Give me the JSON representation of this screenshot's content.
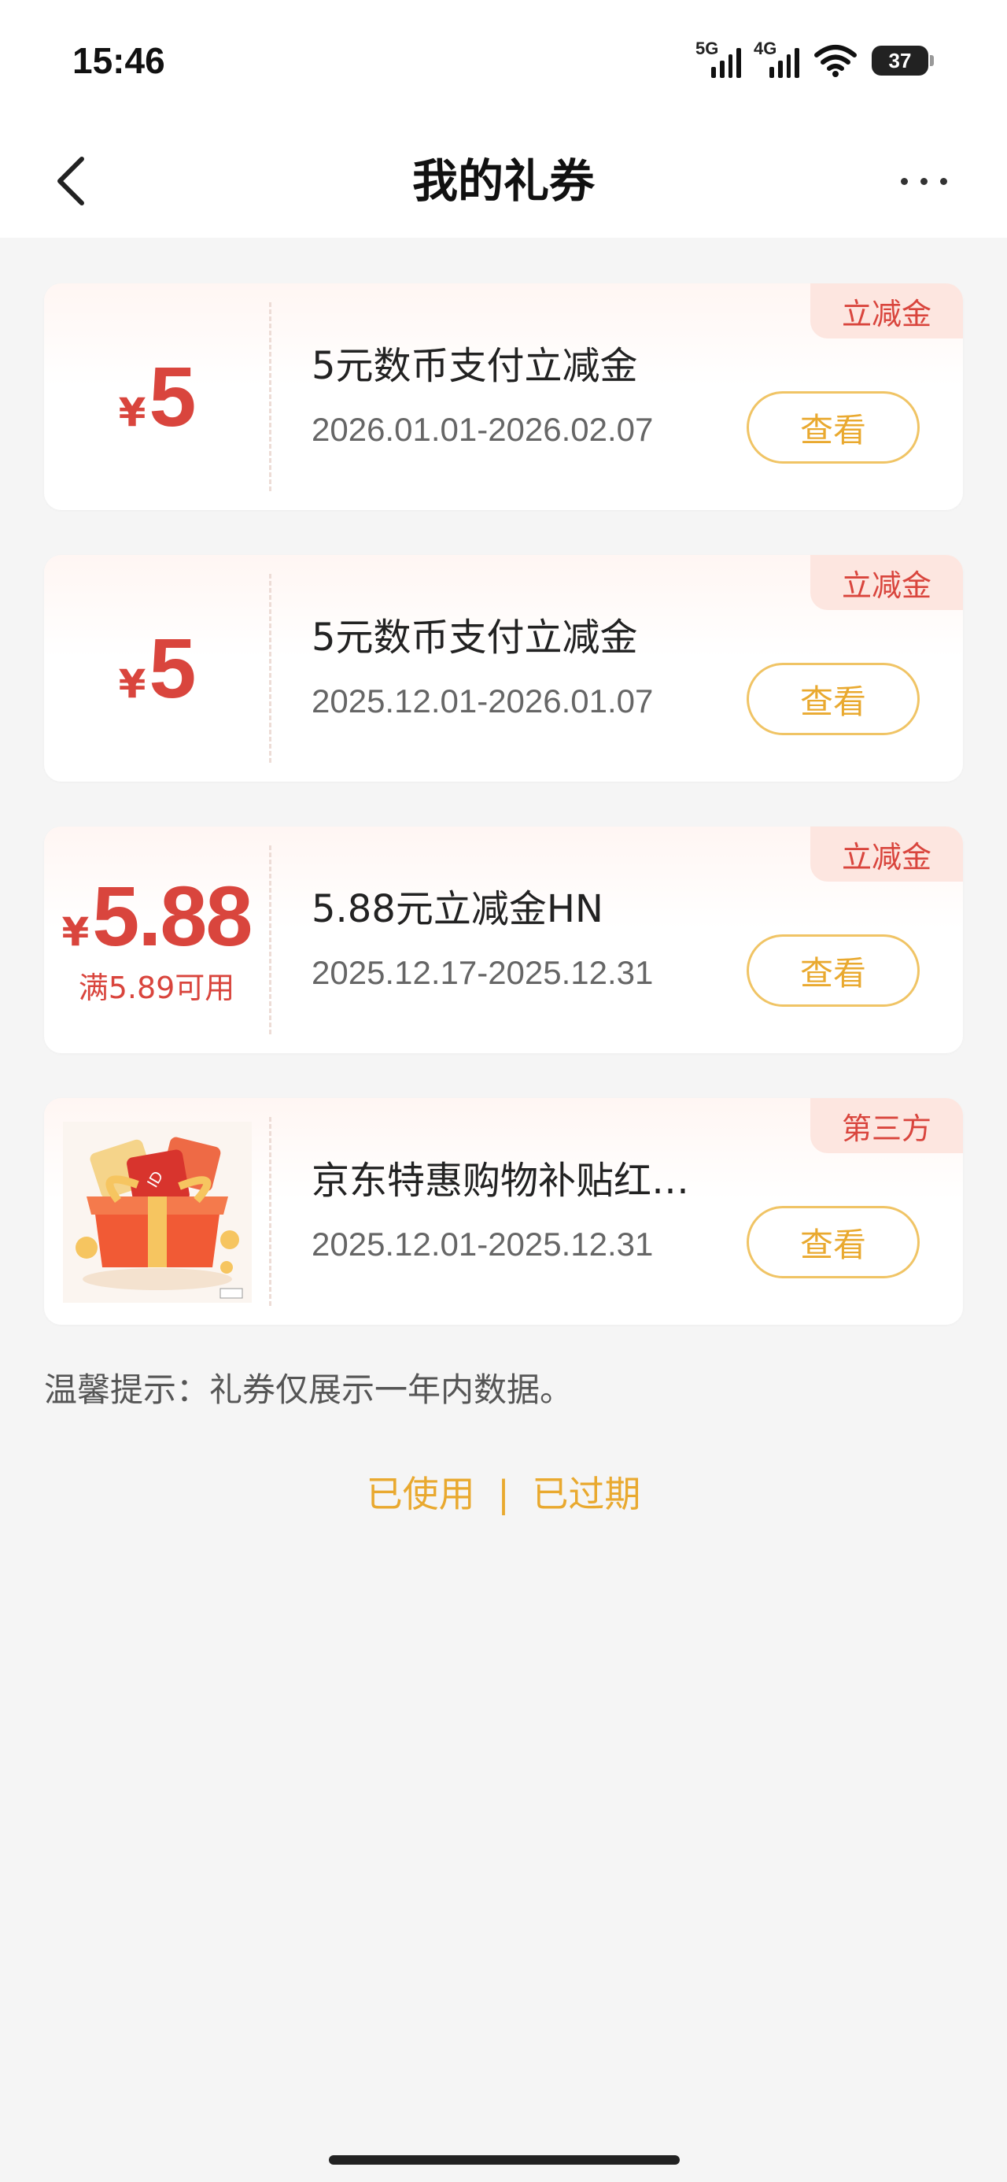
{
  "status_bar": {
    "time": "15:46",
    "network1": "5G",
    "network2": "4G",
    "battery": "37"
  },
  "header": {
    "title": "我的礼券",
    "back_icon": "chevron-left-icon",
    "more_icon": "more-horizontal-icon"
  },
  "coupons": [
    {
      "currency": "¥",
      "amount": "5",
      "condition": "",
      "title": "5元数币支付立减金",
      "date": "2026.01.01-2026.02.07",
      "tag": "立减金",
      "button": "查看"
    },
    {
      "currency": "¥",
      "amount": "5",
      "condition": "",
      "title": "5元数币支付立减金",
      "date": "2025.12.01-2026.01.07",
      "tag": "立减金",
      "button": "查看"
    },
    {
      "currency": "¥",
      "amount": "5.88",
      "condition": "满5.89可用",
      "title": "5.88元立减金HN",
      "date": "2025.12.17-2025.12.31",
      "tag": "立减金",
      "button": "查看"
    },
    {
      "image": "gift-box-icon",
      "title": "京东特惠购物补贴红…",
      "date": "2025.12.01-2025.12.31",
      "tag": "第三方",
      "button": "查看"
    }
  ],
  "tip": "温馨提示：礼券仅展示一年内数据。",
  "links": {
    "used": "已使用",
    "separator": "|",
    "expired": "已过期"
  },
  "colors": {
    "accent_red": "#d9453d",
    "accent_gold": "#e9a92f",
    "tag_bg": "#fde6e0"
  }
}
